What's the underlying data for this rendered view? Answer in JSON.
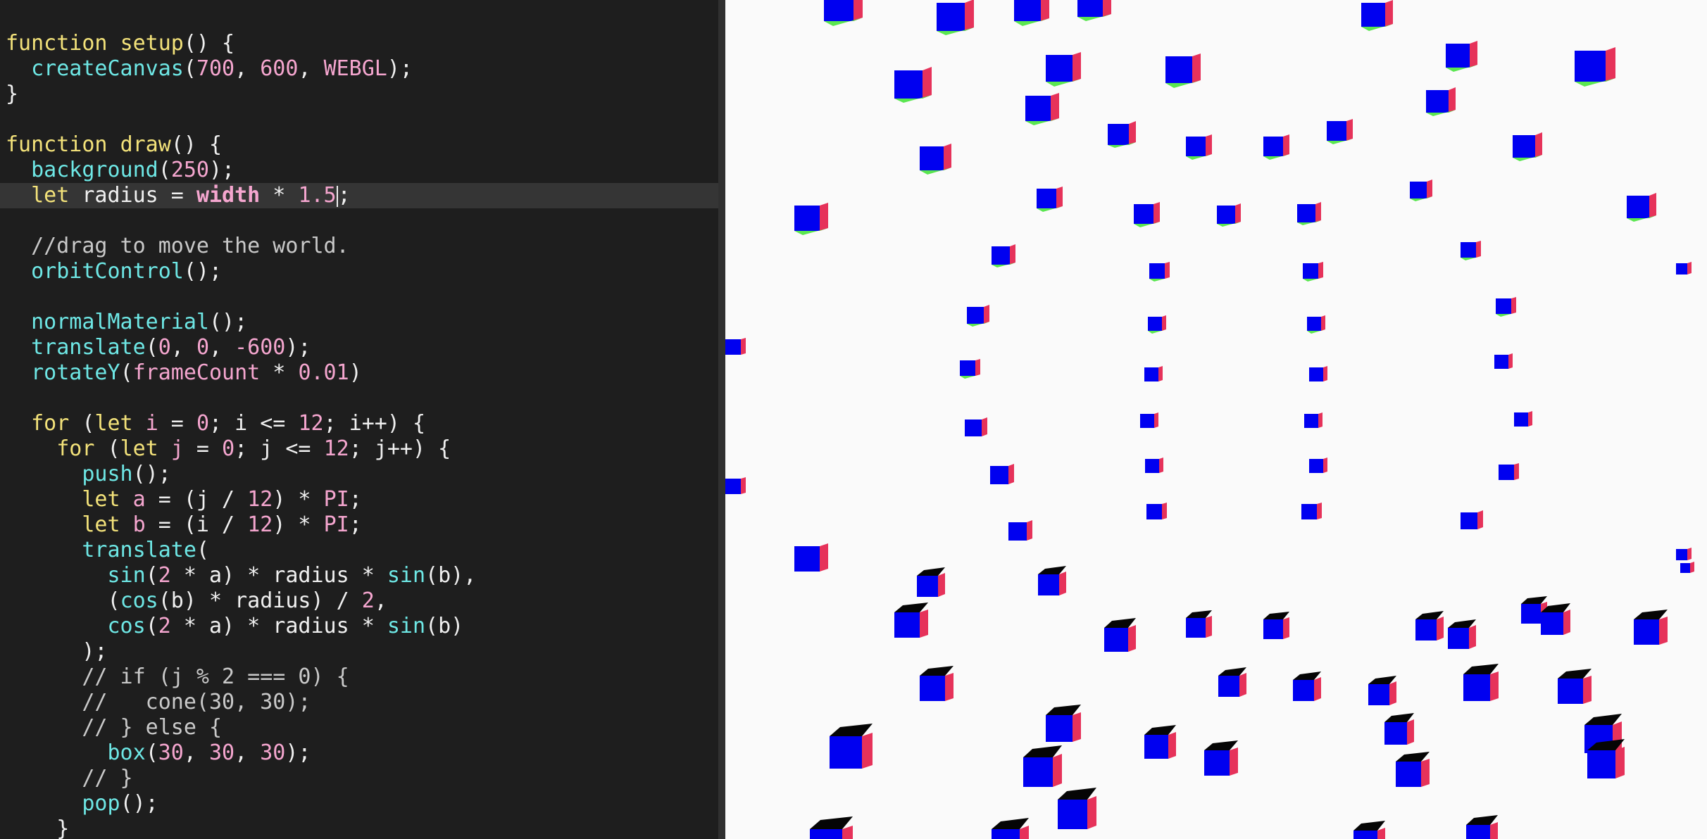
{
  "editor": {
    "active_line": 6,
    "code_lines": [
      [
        {
          "t": "function",
          "k": "kw"
        },
        {
          "t": " ",
          "k": "op"
        },
        {
          "t": "setup",
          "k": "kw"
        },
        {
          "t": "() {",
          "k": "op"
        }
      ],
      [
        {
          "t": "  ",
          "k": "op"
        },
        {
          "t": "createCanvas",
          "k": "fn"
        },
        {
          "t": "(",
          "k": "op"
        },
        {
          "t": "700",
          "k": "num"
        },
        {
          "t": ", ",
          "k": "op"
        },
        {
          "t": "600",
          "k": "num"
        },
        {
          "t": ", ",
          "k": "op"
        },
        {
          "t": "WEBGL",
          "k": "const"
        },
        {
          "t": ");",
          "k": "op"
        }
      ],
      [
        {
          "t": "}",
          "k": "op"
        }
      ],
      [],
      [
        {
          "t": "function",
          "k": "kw"
        },
        {
          "t": " ",
          "k": "op"
        },
        {
          "t": "draw",
          "k": "kw"
        },
        {
          "t": "() {",
          "k": "op"
        }
      ],
      [
        {
          "t": "  ",
          "k": "op"
        },
        {
          "t": "background",
          "k": "fn"
        },
        {
          "t": "(",
          "k": "op"
        },
        {
          "t": "250",
          "k": "num"
        },
        {
          "t": ");",
          "k": "op"
        }
      ],
      [
        {
          "t": "  ",
          "k": "op"
        },
        {
          "t": "let",
          "k": "kw"
        },
        {
          "t": " radius = ",
          "k": "op"
        },
        {
          "t": "width",
          "k": "builtin"
        },
        {
          "t": " * ",
          "k": "op"
        },
        {
          "t": "1.5",
          "k": "num"
        },
        {
          "t": "",
          "k": "cursor"
        },
        {
          "t": ";",
          "k": "op"
        }
      ],
      [],
      [
        {
          "t": "  //drag to move the world.",
          "k": "cm"
        }
      ],
      [
        {
          "t": "  ",
          "k": "op"
        },
        {
          "t": "orbitControl",
          "k": "fn"
        },
        {
          "t": "();",
          "k": "op"
        }
      ],
      [],
      [
        {
          "t": "  ",
          "k": "op"
        },
        {
          "t": "normalMaterial",
          "k": "fn"
        },
        {
          "t": "();",
          "k": "op"
        }
      ],
      [
        {
          "t": "  ",
          "k": "op"
        },
        {
          "t": "translate",
          "k": "fn"
        },
        {
          "t": "(",
          "k": "op"
        },
        {
          "t": "0",
          "k": "num"
        },
        {
          "t": ", ",
          "k": "op"
        },
        {
          "t": "0",
          "k": "num"
        },
        {
          "t": ", ",
          "k": "op"
        },
        {
          "t": "-600",
          "k": "num"
        },
        {
          "t": ");",
          "k": "op"
        }
      ],
      [
        {
          "t": "  ",
          "k": "op"
        },
        {
          "t": "rotateY",
          "k": "fn"
        },
        {
          "t": "(",
          "k": "op"
        },
        {
          "t": "frameCount",
          "k": "const"
        },
        {
          "t": " * ",
          "k": "op"
        },
        {
          "t": "0.01",
          "k": "num"
        },
        {
          "t": ")",
          "k": "op"
        }
      ],
      [],
      [
        {
          "t": "  ",
          "k": "op"
        },
        {
          "t": "for",
          "k": "kw"
        },
        {
          "t": " (",
          "k": "op"
        },
        {
          "t": "let",
          "k": "kw"
        },
        {
          "t": " ",
          "k": "op"
        },
        {
          "t": "i",
          "k": "const"
        },
        {
          "t": " = ",
          "k": "op"
        },
        {
          "t": "0",
          "k": "num"
        },
        {
          "t": "; i <= ",
          "k": "op"
        },
        {
          "t": "12",
          "k": "num"
        },
        {
          "t": "; i++) {",
          "k": "op"
        }
      ],
      [
        {
          "t": "    ",
          "k": "op"
        },
        {
          "t": "for",
          "k": "kw"
        },
        {
          "t": " (",
          "k": "op"
        },
        {
          "t": "let",
          "k": "kw"
        },
        {
          "t": " ",
          "k": "op"
        },
        {
          "t": "j",
          "k": "const"
        },
        {
          "t": " = ",
          "k": "op"
        },
        {
          "t": "0",
          "k": "num"
        },
        {
          "t": "; j <= ",
          "k": "op"
        },
        {
          "t": "12",
          "k": "num"
        },
        {
          "t": "; j++) {",
          "k": "op"
        }
      ],
      [
        {
          "t": "      ",
          "k": "op"
        },
        {
          "t": "push",
          "k": "fn"
        },
        {
          "t": "();",
          "k": "op"
        }
      ],
      [
        {
          "t": "      ",
          "k": "op"
        },
        {
          "t": "let",
          "k": "kw"
        },
        {
          "t": " ",
          "k": "op"
        },
        {
          "t": "a",
          "k": "const"
        },
        {
          "t": " = (j / ",
          "k": "op"
        },
        {
          "t": "12",
          "k": "num"
        },
        {
          "t": ") * ",
          "k": "op"
        },
        {
          "t": "PI",
          "k": "const"
        },
        {
          "t": ";",
          "k": "op"
        }
      ],
      [
        {
          "t": "      ",
          "k": "op"
        },
        {
          "t": "let",
          "k": "kw"
        },
        {
          "t": " ",
          "k": "op"
        },
        {
          "t": "b",
          "k": "const"
        },
        {
          "t": " = (i / ",
          "k": "op"
        },
        {
          "t": "12",
          "k": "num"
        },
        {
          "t": ") * ",
          "k": "op"
        },
        {
          "t": "PI",
          "k": "const"
        },
        {
          "t": ";",
          "k": "op"
        }
      ],
      [
        {
          "t": "      ",
          "k": "op"
        },
        {
          "t": "translate",
          "k": "fn"
        },
        {
          "t": "(",
          "k": "op"
        }
      ],
      [
        {
          "t": "        ",
          "k": "op"
        },
        {
          "t": "sin",
          "k": "fn"
        },
        {
          "t": "(",
          "k": "op"
        },
        {
          "t": "2",
          "k": "num"
        },
        {
          "t": " * a) * radius * ",
          "k": "op"
        },
        {
          "t": "sin",
          "k": "fn"
        },
        {
          "t": "(b),",
          "k": "op"
        }
      ],
      [
        {
          "t": "        (",
          "k": "op"
        },
        {
          "t": "cos",
          "k": "fn"
        },
        {
          "t": "(b) * radius) / ",
          "k": "op"
        },
        {
          "t": "2",
          "k": "num"
        },
        {
          "t": ",",
          "k": "op"
        }
      ],
      [
        {
          "t": "        ",
          "k": "op"
        },
        {
          "t": "cos",
          "k": "fn"
        },
        {
          "t": "(",
          "k": "op"
        },
        {
          "t": "2",
          "k": "num"
        },
        {
          "t": " * a) * radius * ",
          "k": "op"
        },
        {
          "t": "sin",
          "k": "fn"
        },
        {
          "t": "(b)",
          "k": "op"
        }
      ],
      [
        {
          "t": "      );",
          "k": "op"
        }
      ],
      [
        {
          "t": "      // if (j % 2 === 0) {",
          "k": "cm"
        }
      ],
      [
        {
          "t": "      //   cone(30, 30);",
          "k": "cm"
        }
      ],
      [
        {
          "t": "      // } else {",
          "k": "cm"
        }
      ],
      [
        {
          "t": "        ",
          "k": "op"
        },
        {
          "t": "box",
          "k": "fn"
        },
        {
          "t": "(",
          "k": "op"
        },
        {
          "t": "30",
          "k": "num"
        },
        {
          "t": ", ",
          "k": "op"
        },
        {
          "t": "30",
          "k": "num"
        },
        {
          "t": ", ",
          "k": "op"
        },
        {
          "t": "30",
          "k": "num"
        },
        {
          "t": ");",
          "k": "op"
        }
      ],
      [
        {
          "t": "      // }",
          "k": "cm"
        }
      ],
      [
        {
          "t": "      ",
          "k": "op"
        },
        {
          "t": "pop",
          "k": "fn"
        },
        {
          "t": "();",
          "k": "op"
        }
      ],
      [
        {
          "t": "    }",
          "k": "op"
        }
      ]
    ]
  },
  "preview": {
    "background_color": "#fafafa",
    "cube_colors": {
      "front": "#0000f0",
      "right": "#e6325a",
      "top": "#5ae650",
      "shadow": "#050505"
    }
  }
}
